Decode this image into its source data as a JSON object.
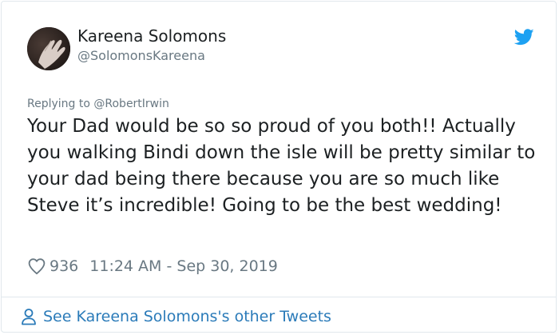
{
  "tweet": {
    "author": {
      "display_name": "Kareena Solomons",
      "handle": "@SolomonsKareena"
    },
    "reply_context": {
      "prefix": "Replying to",
      "mention": "@RobertIrwin"
    },
    "text": "Your Dad would be so so proud of you both!! Actually you walking Bindi down the isle will be pretty similar to your dad being there because you are so much like Steve it’s incredible! Going to be the best wedding!",
    "likes": "936",
    "timestamp": "11:24 AM - Sep 30, 2019"
  },
  "footer": {
    "link_label": "See Kareena Solomons's other Tweets"
  },
  "colors": {
    "twitter_blue": "#1da1f2",
    "link_blue": "#2b7bb9",
    "muted_gray": "#697882",
    "text": "#1c2022",
    "border": "#e1e8ed"
  },
  "icons": {
    "brand": "twitter-bird-icon",
    "like": "heart-icon",
    "profile": "person-icon"
  }
}
